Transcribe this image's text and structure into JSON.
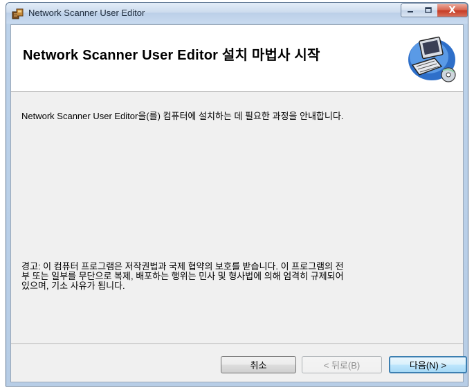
{
  "window": {
    "title": "Network Scanner User Editor",
    "controls": {
      "minimize": "—",
      "maximize": "□",
      "close": "X"
    }
  },
  "banner": {
    "title": "Network Scanner User Editor 설치 마법사 시작",
    "graphic": "computer-install-icon"
  },
  "body": {
    "description": "Network Scanner User Editor을(를) 컴퓨터에 설치하는 데 필요한 과정을 안내합니다.",
    "warning": "경고: 이 컴퓨터 프로그램은 저작권법과 국제 협약의 보호를 받습니다. 이 프로그램의 전\n부 또는 일부를 무단으로 복제, 배포하는 행위는 민사 및 형사법에 의해 엄격히 규제되어\n있으며, 기소 사유가 됩니다."
  },
  "buttons": {
    "cancel": "취소",
    "back": "< 뒤로(B)",
    "next": "다음(N) >"
  },
  "colors": {
    "default_button_border": "#3c7fb1",
    "close_button": "#c53a24"
  }
}
